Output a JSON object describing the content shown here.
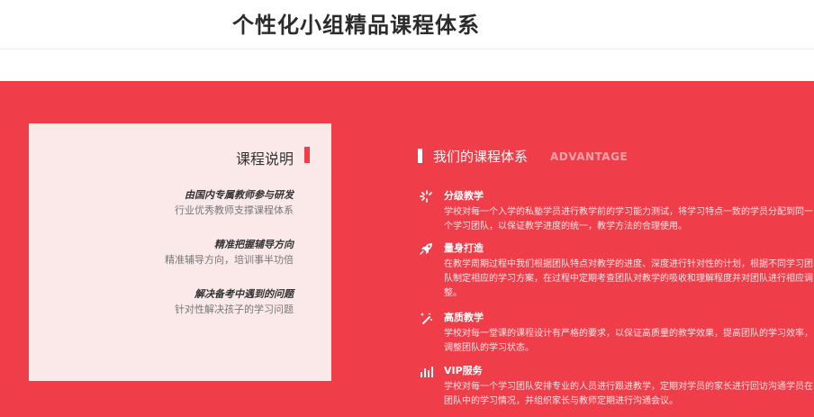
{
  "page_title": "个性化小组精品课程体系",
  "course_card": {
    "heading": "课程说明",
    "items": [
      {
        "title": "由国内专属教师参与研发",
        "desc": "行业优秀教师支撑课程体系"
      },
      {
        "title": "精准把握辅导方向",
        "desc": "精准辅导方向，培训事半功倍"
      },
      {
        "title": "解决备考中遇到的问题",
        "desc": "针对性解决孩子的学习问题"
      }
    ]
  },
  "system": {
    "heading": "我们的课程体系",
    "heading_en": "ADVANTAGE",
    "features": [
      {
        "icon": "loading-spinner-icon",
        "title": "分级教学",
        "desc": "学校对每一个入学的私塾学员进行教学前的学习能力测试，将学习特点一致的学员分配到同一个学习团队，以保证教学进度的统一，教学方法的合理使用。"
      },
      {
        "icon": "rocket-icon",
        "title": "量身打造",
        "desc": "在教学周期过程中我们根据团队特点对教学的进度、深度进行针对性的计划，根据不同学习团队制定相应的学习方案，在过程中定期考查团队对教学的吸收和理解程度并对团队进行相应调整。"
      },
      {
        "icon": "magic-wand-icon",
        "title": "高质教学",
        "desc": "学校对每一堂课的课程设计有严格的要求，以保证高质量的教学效果，提高团队的学习效率，调整团队的学习状态。"
      },
      {
        "icon": "bar-chart-icon",
        "title": "VIP服务",
        "desc": "学校对每一个学习团队安排专业的人员进行跟进教学，定期对学员的家长进行回访沟通学员在团队中的学习情况，并组织家长与教师定期进行沟通会议。"
      }
    ]
  },
  "colors": {
    "accent": "#ef3e4a",
    "card_bg": "#fbe9ea",
    "subtle_en": "#f8a3aa"
  }
}
